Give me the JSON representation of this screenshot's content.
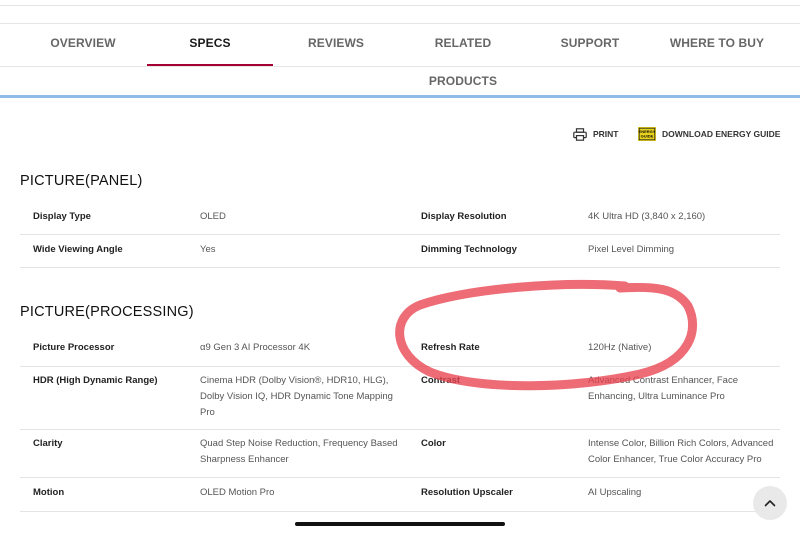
{
  "tabs": [
    {
      "label": "OVERVIEW"
    },
    {
      "label": "SPECS"
    },
    {
      "label": "REVIEWS"
    },
    {
      "label": "RELATED PRODUCTS"
    },
    {
      "label": "SUPPORT"
    },
    {
      "label": "WHERE TO BUY"
    }
  ],
  "active_tab": "SPECS",
  "utility": {
    "print_label": "PRINT",
    "print_icon": "printer-icon",
    "energy_label": "DOWNLOAD ENERGY GUIDE",
    "energy_icon": "energy-guide-icon",
    "energy_icon_text": "ENERGY GUIDE"
  },
  "sections": [
    {
      "title": "PICTURE(PANEL)",
      "rows": [
        {
          "l1": "Display Type",
          "v1": "OLED",
          "l2": "Display Resolution",
          "v2": "4K Ultra HD (3,840 x 2,160)"
        },
        {
          "l1": "Wide Viewing Angle",
          "v1": "Yes",
          "l2": "Dimming Technology",
          "v2": "Pixel Level Dimming"
        }
      ]
    },
    {
      "title": "PICTURE(PROCESSING)",
      "rows": [
        {
          "l1": "Picture Processor",
          "v1": "α9 Gen 3 AI Processor 4K",
          "l2": "Refresh Rate",
          "v2": "120Hz (Native)"
        },
        {
          "l1": "HDR (High Dynamic Range)",
          "v1": "Cinema HDR (Dolby Vision®, HDR10, HLG), Dolby Vision IQ, HDR Dynamic Tone Mapping Pro",
          "l2": "Contrast",
          "v2": "Advanced Contrast Enhancer, Face Enhancing, Ultra Luminance Pro"
        },
        {
          "l1": "Clarity",
          "v1": "Quad Step Noise Reduction, Frequency Based Sharpness Enhancer",
          "l2": "Color",
          "v2": "Intense Color, Billion Rich Colors, Advanced Color Enhancer, True Color Accuracy Pro"
        },
        {
          "l1": "Motion",
          "v1": "OLED Motion Pro",
          "l2": "Resolution Upscaler",
          "v2": "AI Upscaling"
        }
      ]
    }
  ],
  "scroll_top_icon": "chevron-up-icon",
  "colors": {
    "accent": "#a50034",
    "band": "#8fbce6",
    "annotation": "#e8424f"
  }
}
